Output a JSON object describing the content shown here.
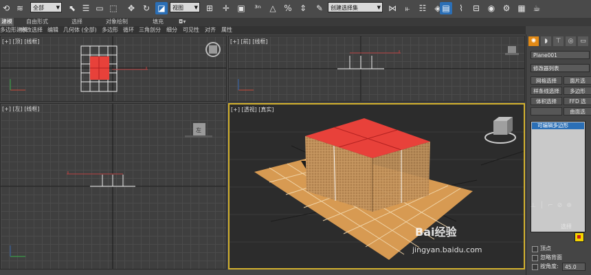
{
  "toolbar": {
    "selection_filter": "全部",
    "coordinate_system": "视图",
    "named_selection_set": "创建选择集"
  },
  "ribbon_tabs": [
    "建模",
    "自由形式",
    "选择",
    "对象绘制",
    "填充"
  ],
  "ribbon_sub": [
    "多边形建模",
    "修改选择",
    "编辑",
    "几何体 (全部)",
    "多边形",
    "循环",
    "三角剖分",
    "细分",
    "可见性",
    "对齐",
    "属性"
  ],
  "viewports": {
    "top": "[+] [顶] [线框]",
    "front": "[+] [前] [线框]",
    "left": "[+] [左] [线框]",
    "perspective": "[+] [透视] [真实]"
  },
  "viewcube": {
    "left_face": "左"
  },
  "command_panel": {
    "object_name": "Plane001",
    "modifier_list": "修改器列表",
    "buttons": [
      "网格选择",
      "面片选",
      "样条线选择",
      "多边形",
      "体积选择",
      "FFD 选",
      "",
      "曲面选"
    ],
    "stack_item": "可编辑多边形",
    "rollout_title": "选择",
    "checkbox_labels": [
      "顶点",
      "忽略背面",
      "按角度:"
    ],
    "angle_value": "45.0"
  },
  "watermark": {
    "brand": "Bai经验",
    "url": "jingyan.baidu.com"
  },
  "colors": {
    "selection": "#e8413a",
    "floor": "#d79a52",
    "box": "#b98a52",
    "active_border": "#d4b22e",
    "accent_blue": "#2b6fb6",
    "active_tab": "#e28a16"
  }
}
